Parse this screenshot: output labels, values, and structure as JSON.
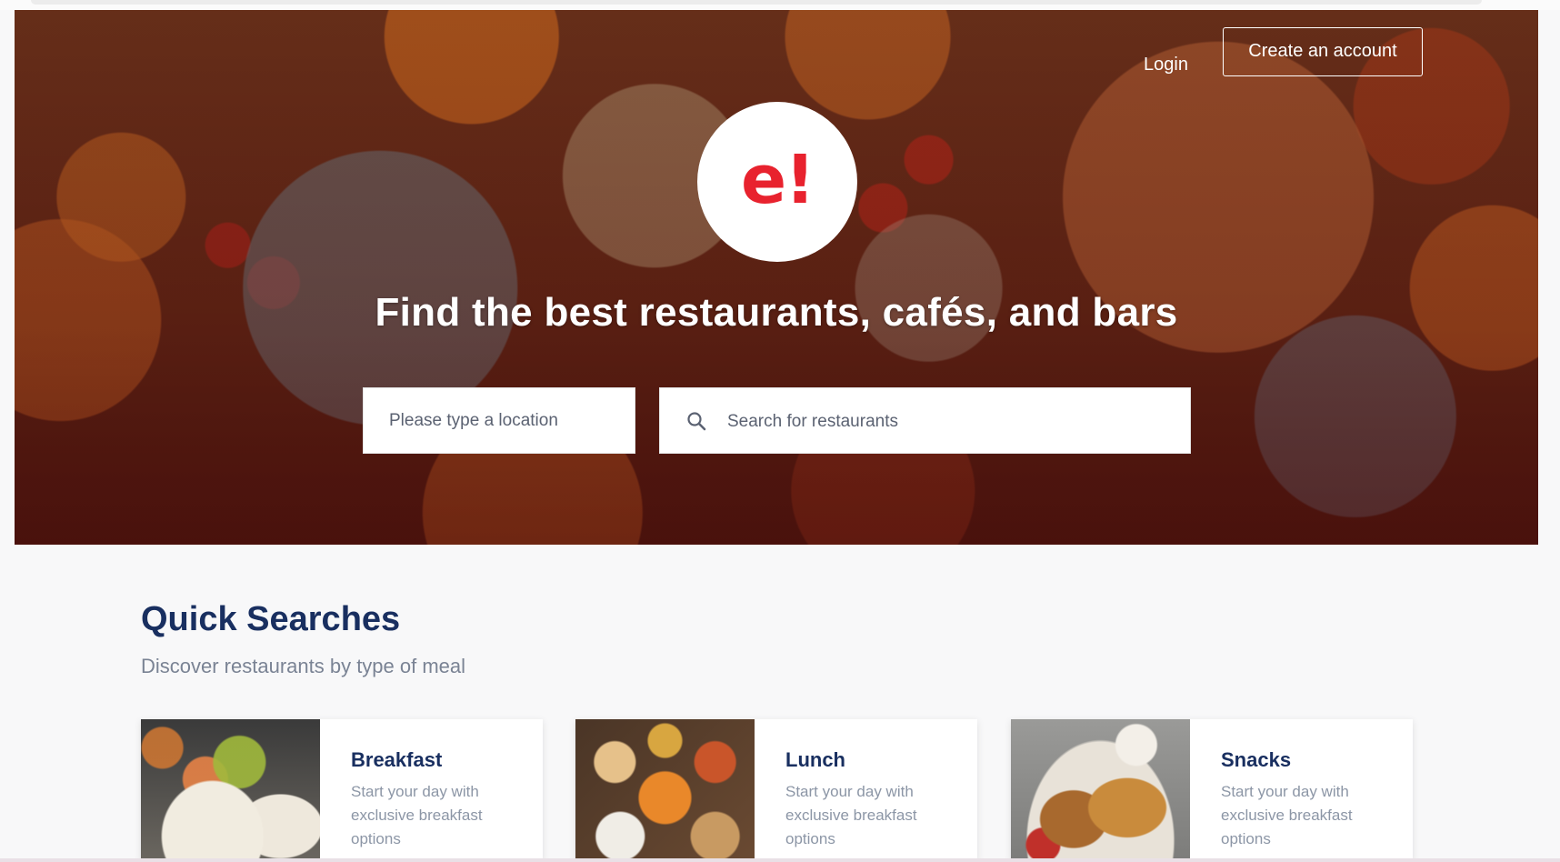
{
  "header": {
    "login_label": "Login",
    "create_account_label": "Create an account"
  },
  "hero": {
    "logo_text": "e!",
    "headline": "Find the best restaurants, cafés, and bars",
    "location_placeholder": "Please type a location",
    "search_placeholder": "Search for restaurants",
    "search_icon": "search-icon"
  },
  "quick_searches": {
    "title": "Quick Searches",
    "subtitle": "Discover restaurants by type of meal",
    "cards": [
      {
        "title": "Breakfast",
        "description": "Start your day with exclusive breakfast options"
      },
      {
        "title": "Lunch",
        "description": "Start your day with exclusive breakfast options"
      },
      {
        "title": "Snacks",
        "description": "Start your day with exclusive breakfast options"
      }
    ]
  },
  "colors": {
    "brand_red": "#e8222e",
    "heading_navy": "#192f60",
    "muted_text": "#8c96a6"
  }
}
